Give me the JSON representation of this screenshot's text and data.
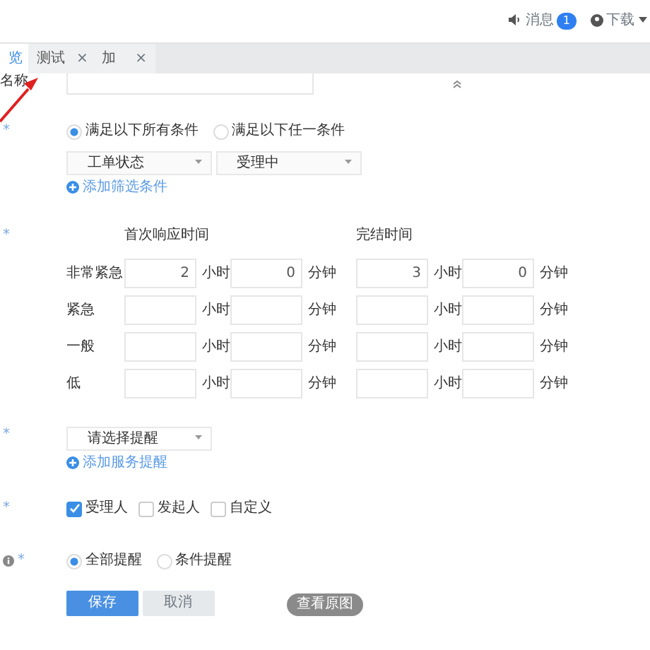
{
  "header": {
    "notifications": {
      "label": "消息",
      "badge": "1"
    },
    "user": {
      "label": "下载"
    }
  },
  "tabs": [
    {
      "label": "览",
      "selected": true
    },
    {
      "label": "测试",
      "selected": false,
      "close": "×"
    },
    {
      "label": "加",
      "selected": false,
      "close": "×"
    }
  ],
  "name_field": {
    "label": "名称"
  },
  "condition_match": {
    "required_mark": "*",
    "options": [
      {
        "label": "满足以下所有条件",
        "selected": true
      },
      {
        "label": "满足以下任一条件",
        "selected": false
      }
    ]
  },
  "filters": [
    {
      "value": "工单状态"
    },
    {
      "value": "受理中"
    }
  ],
  "add_filter": "添加筛选条件",
  "sla": {
    "required_mark": "*",
    "columns": [
      "首次响应时间",
      "完结时间"
    ],
    "rows": [
      {
        "priority": "非常紧急",
        "cells": [
          {
            "value": "2",
            "unit": "小时"
          },
          {
            "value": "0",
            "unit": "分钟"
          },
          {
            "value": "3",
            "unit": "小时"
          },
          {
            "value": "0",
            "unit": "分钟"
          }
        ]
      },
      {
        "priority": "紧急",
        "cells": [
          {
            "unit": "小时"
          },
          {
            "unit": "分钟"
          },
          {
            "unit": "小时"
          },
          {
            "unit": "分钟"
          }
        ]
      },
      {
        "priority": "一般",
        "cells": [
          {
            "unit": "小时"
          },
          {
            "unit": "分钟"
          },
          {
            "unit": "小时"
          },
          {
            "unit": "分钟"
          }
        ]
      },
      {
        "priority": "低",
        "cells": [
          {
            "unit": "小时"
          },
          {
            "unit": "分钟"
          },
          {
            "unit": "小时"
          },
          {
            "unit": "分钟"
          }
        ]
      }
    ]
  },
  "reminder": {
    "required_mark": "*",
    "placeholder": "请选择提醒",
    "add_link": "添加服务提醒"
  },
  "recipients": {
    "required_mark": "*",
    "options": [
      {
        "label": "受理人",
        "checked": true
      },
      {
        "label": "发起人",
        "checked": false
      },
      {
        "label": "自定义",
        "checked": false
      }
    ]
  },
  "notify_mode": {
    "required_mark": "*",
    "info": true,
    "options": [
      {
        "label": "全部提醒",
        "selected": true
      },
      {
        "label": "条件提醒",
        "selected": false
      }
    ]
  },
  "buttons": [
    {
      "label": "保存",
      "kind": "primary"
    },
    {
      "label": "取消",
      "kind": "secondary"
    }
  ],
  "view_original": "查看原图"
}
